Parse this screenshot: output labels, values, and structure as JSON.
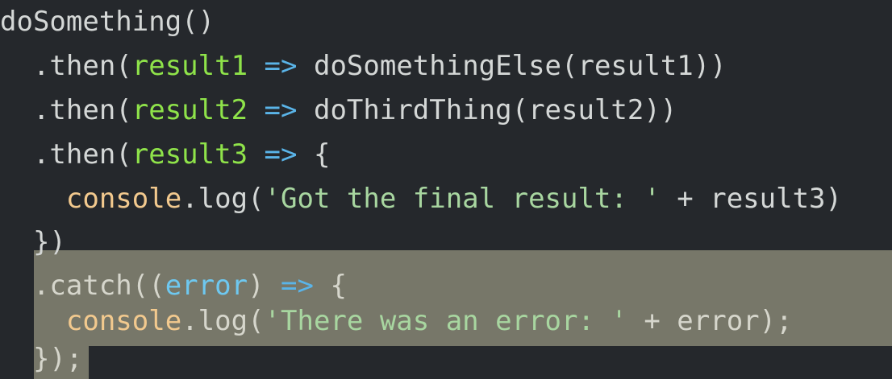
{
  "code": {
    "lines": [
      {
        "segments": [
          {
            "text": "doSomething()",
            "cls": "c-default"
          }
        ]
      },
      {
        "segments": [
          {
            "text": "  .then(",
            "cls": "c-default"
          },
          {
            "text": "result1",
            "cls": "c-param"
          },
          {
            "text": " ",
            "cls": "c-default"
          },
          {
            "text": "=>",
            "cls": "c-arrow"
          },
          {
            "text": " doSomethingElse(result1))",
            "cls": "c-default"
          }
        ]
      },
      {
        "segments": [
          {
            "text": "  .then(",
            "cls": "c-default"
          },
          {
            "text": "result2",
            "cls": "c-param"
          },
          {
            "text": " ",
            "cls": "c-default"
          },
          {
            "text": "=>",
            "cls": "c-arrow"
          },
          {
            "text": " doThirdThing(result2))",
            "cls": "c-default"
          }
        ]
      },
      {
        "segments": [
          {
            "text": "  .then(",
            "cls": "c-default"
          },
          {
            "text": "result3",
            "cls": "c-param"
          },
          {
            "text": " ",
            "cls": "c-default"
          },
          {
            "text": "=>",
            "cls": "c-arrow"
          },
          {
            "text": " {",
            "cls": "c-default"
          }
        ]
      },
      {
        "segments": [
          {
            "text": "    ",
            "cls": "c-default"
          },
          {
            "text": "console",
            "cls": "c-obj"
          },
          {
            "text": ".log(",
            "cls": "c-default"
          },
          {
            "text": "'Got the final result: '",
            "cls": "c-str"
          },
          {
            "text": " + result3)",
            "cls": "c-default"
          }
        ]
      },
      {
        "segments": [
          {
            "text": "  })",
            "cls": "c-default"
          }
        ]
      },
      {
        "segments": [
          {
            "text": "  .catch((",
            "cls": "c-punct-sel"
          },
          {
            "text": "error",
            "cls": "c-param-sel"
          },
          {
            "text": ") ",
            "cls": "c-punct-sel"
          },
          {
            "text": "=>",
            "cls": "c-arrow"
          },
          {
            "text": " {",
            "cls": "c-punct-sel"
          }
        ]
      },
      {
        "segments": [
          {
            "text": "    ",
            "cls": "c-default"
          },
          {
            "text": "console",
            "cls": "c-obj"
          },
          {
            "text": ".log(",
            "cls": "c-punct-sel"
          },
          {
            "text": "'There was an error: '",
            "cls": "c-str"
          },
          {
            "text": " + error);",
            "cls": "c-punct-sel"
          }
        ]
      },
      {
        "segments": [
          {
            "text": "  });",
            "cls": "c-punct-sel"
          }
        ]
      }
    ]
  },
  "colors": {
    "background": "#25282c",
    "selection": "#777769",
    "parameter": "#8fe34a",
    "arrow": "#5ab4e8",
    "object": "#f2c98e",
    "string": "#a8d6a0"
  }
}
